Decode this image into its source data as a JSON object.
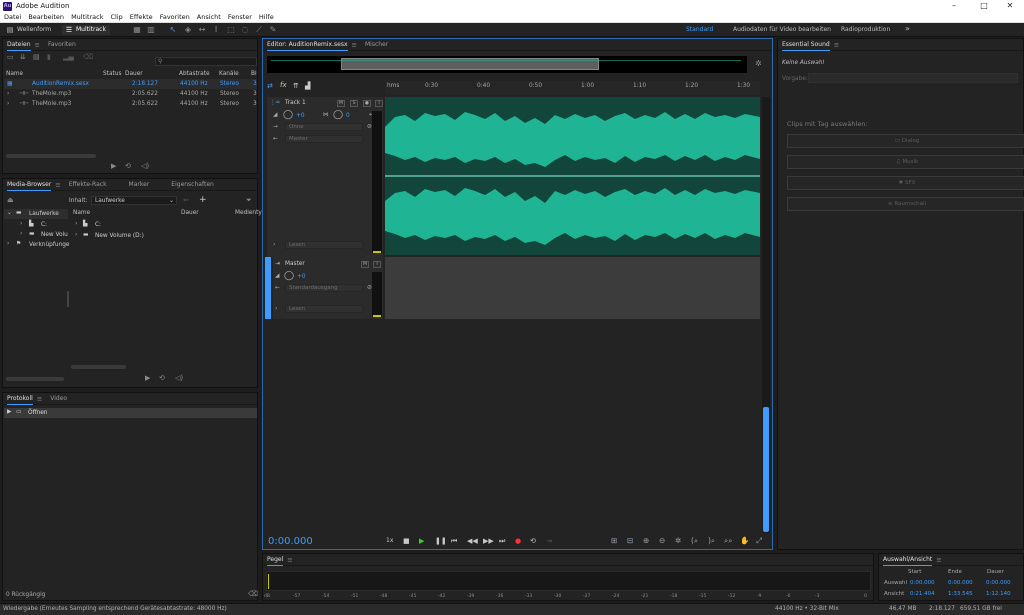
{
  "app": {
    "title": "Adobe Audition",
    "logo": "Au"
  },
  "menu": [
    "Datei",
    "Bearbeiten",
    "Multitrack",
    "Clip",
    "Effekte",
    "Favoriten",
    "Ansicht",
    "Fenster",
    "Hilfe"
  ],
  "toolbar": {
    "waveform_label": "Wellenform",
    "multitrack_label": "Multitrack",
    "workspaces": [
      "Standard",
      "Audiodaten für Video bearbeiten",
      "Radioproduktion"
    ],
    "more": "»"
  },
  "files": {
    "tabs": [
      "Dateien",
      "Favoriten"
    ],
    "columns": [
      "Name",
      "Status",
      "Dauer",
      "Abtastrate",
      "Kanäle",
      "Bi"
    ],
    "rows": [
      {
        "name": "AuditionRemix.sesx",
        "duration": "2:18.127",
        "rate": "44100 Hz",
        "channels": "Stereo",
        "bits": "3"
      },
      {
        "name": "TheMole.mp3",
        "duration": "2:05.622",
        "rate": "44100 Hz",
        "channels": "Stereo",
        "bits": "3"
      },
      {
        "name": "TheMole.mp3",
        "duration": "2:05.622",
        "rate": "44100 Hz",
        "channels": "Stereo",
        "bits": "3"
      }
    ]
  },
  "media": {
    "tabs": [
      "Media-Browser",
      "Effekte-Rack",
      "Marker",
      "Eigenschaften"
    ],
    "content_label": "Inhalt:",
    "content_value": "Laufwerke",
    "tree": [
      "Laufwerke",
      "C:",
      "New Volu",
      "Verknüpfunge"
    ],
    "columns": [
      "Name",
      "Dauer",
      "Medienty"
    ],
    "items": [
      "C:",
      "New Volume (D:)"
    ]
  },
  "history": {
    "tabs": [
      "Protokoll",
      "Video"
    ],
    "items": [
      "Öffnen"
    ],
    "undo": "0 Rückgängig"
  },
  "editor": {
    "tabs": [
      "Editor: AuditionRemix.sesx",
      "Mischer"
    ],
    "ruler": [
      "hms",
      "0:30",
      "0:40",
      "0:50",
      "1:00",
      "1:10",
      "1:20",
      "1:30"
    ],
    "time": "0:00.000",
    "speed": "1x",
    "tracks": [
      {
        "name": "Track 1",
        "volume": "+0",
        "pan": "0",
        "input": "Ohne",
        "output": "Master",
        "read": "Lesen",
        "mute": "M",
        "solo": "S"
      },
      {
        "name": "Master",
        "volume": "+0",
        "input": "Standardausgang",
        "read": "Lesen",
        "mute": "M"
      }
    ]
  },
  "essential": {
    "title": "Essential Sound",
    "no_selection": "Keine Auswahl",
    "preset_label": "Vorgabe:",
    "clips_heading": "Clips mit Tag auswählen:",
    "buttons": [
      "Dialog",
      "Musik",
      "SFX",
      "Raumschall"
    ]
  },
  "meter": {
    "title": "Pegel",
    "scale": [
      "dB",
      "-57",
      "-54",
      "-51",
      "-48",
      "-45",
      "-42",
      "-39",
      "-36",
      "-33",
      "-30",
      "-27",
      "-24",
      "-21",
      "-18",
      "-15",
      "-12",
      "-9",
      "-6",
      "-3",
      "0"
    ]
  },
  "selection": {
    "title": "Auswahl/Ansicht",
    "headers": [
      "Start",
      "Ende",
      "Dauer"
    ],
    "rows": [
      {
        "label": "Auswahl",
        "start": "0:00.000",
        "end": "0:00.000",
        "dur": "0:00.000"
      },
      {
        "label": "Ansicht",
        "start": "0:21.404",
        "end": "1:33.545",
        "dur": "1:12.140"
      }
    ]
  },
  "status": {
    "message": "Wiedergabe (Erneutes Sampling entsprechend Gerätesabtastrate: 48000 Hz)",
    "format": "44100 Hz • 32-Bit Mix",
    "mem": "46,47 MB",
    "duration": "2:18.127",
    "free": "659,51 GB frei"
  },
  "colors": {
    "accent": "#3d9cff",
    "wave": "#1fb494",
    "wave_bg": "#12463b",
    "master_bg": "#3c3c3c"
  }
}
